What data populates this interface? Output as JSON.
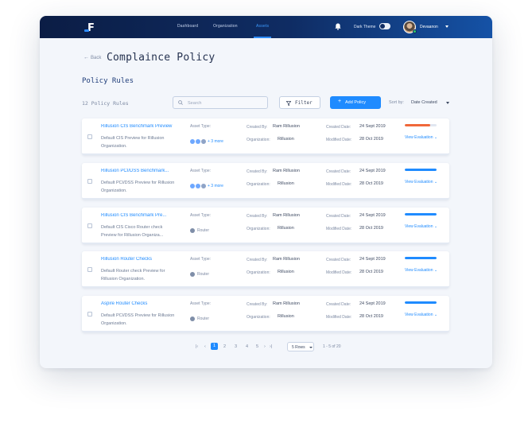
{
  "nav": {
    "logo": "F",
    "links": [
      "Dashboard",
      "Organization",
      "Assets"
    ],
    "active_link": "Assets",
    "dark_theme_label": "Dark Theme",
    "username": "Devaanon"
  },
  "header": {
    "back_label": "Back",
    "page_title": "Complaince Policy",
    "section_title": "Policy Rules",
    "rules_count": "12 Policy Rules",
    "search_placeholder": "Search",
    "filter_label": "Filter",
    "add_label": "Add Policy",
    "sort_label": "Sort by:",
    "sort_value": "Date Created"
  },
  "labels": {
    "asset_type": "Asset Type:",
    "created_by": "Created By:",
    "organization": "Organization:",
    "created_date": "Created Date:",
    "modified_date": "Modified Date:",
    "view_evaluation": "View Evaluation"
  },
  "policies": [
    {
      "name": "Rillusion CIS Benchmark Preview",
      "description": "Default CIS Preview for Rillusion Organization.",
      "asset": "chips",
      "asset_more": "+ 3 more",
      "created_by": "Ram Rillusion",
      "organization": "Rillusion",
      "created_date": "24 Sept 2019",
      "modified_date": "28 Oct 2019",
      "progress": 0.8,
      "progress_color": "#f0683a"
    },
    {
      "name": "Rillusion PCI/DSS Benchmark...",
      "description": "Default PCI/DSS Preview for Rillusion Organization.",
      "asset": "chips",
      "asset_more": "+ 3 more",
      "created_by": "Ram Rillusion",
      "organization": "Rillusion",
      "created_date": "24 Sept 2019",
      "modified_date": "28 Oct 2019",
      "progress": 1.0,
      "progress_color": "#1f8bff"
    },
    {
      "name": "Rillusion CIS Benchmark Pre...",
      "description": "Default CIS Cisco Router check Preview for Rillusion Organiza...",
      "asset": "Router",
      "created_by": "Ram Rillusion",
      "organization": "Rillusion",
      "created_date": "24 Sept 2019",
      "modified_date": "28 Oct 2019",
      "progress": 1.0,
      "progress_color": "#1f8bff"
    },
    {
      "name": "Rillusion Router Checks",
      "description": "Default Router check Preview for Rillusion Organization.",
      "asset": "Router",
      "created_by": "Ram Rillusion",
      "organization": "Rillusion",
      "created_date": "24 Sept 2019",
      "modified_date": "28 Oct 2019",
      "progress": 1.0,
      "progress_color": "#1f8bff"
    },
    {
      "name": "Aspire Router Checks",
      "description": "Default PCI/DSS Preview for Rillusion Organization.",
      "asset": "Router",
      "created_by": "Ram Rillusion",
      "organization": "Rillusion",
      "created_date": "24 Sept 2019",
      "modified_date": "28 Oct 2019",
      "progress": 1.0,
      "progress_color": "#1f8bff"
    }
  ],
  "pagination": {
    "first": "|‹",
    "prev": "‹",
    "pages": [
      "1",
      "2",
      "3",
      "4",
      "5"
    ],
    "active_page": "1",
    "next": "›",
    "last": "›|",
    "rows_label": "5 Rows",
    "range": "1 - 5 of 20"
  }
}
